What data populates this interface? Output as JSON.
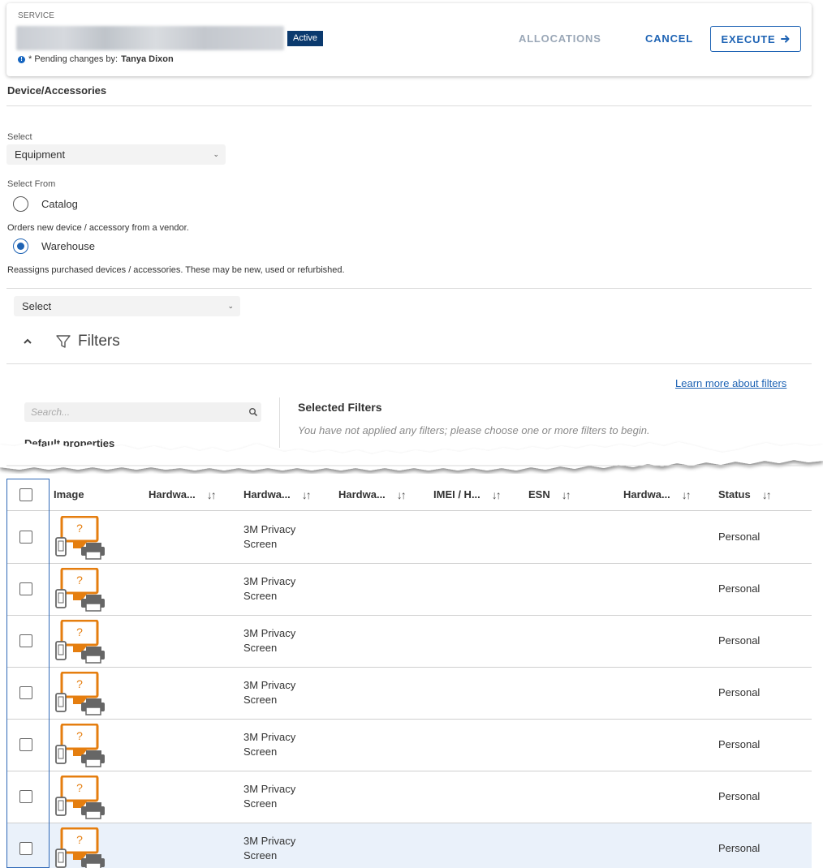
{
  "header": {
    "service_label": "SERVICE",
    "status_badge": "Active",
    "pending_text": "* Pending changes by:",
    "pending_user": "Tanya Dixon",
    "allocations_label": "ALLOCATIONS",
    "cancel_label": "CANCEL",
    "execute_label": "EXECUTE",
    "colors": {
      "primary": "#1e63b4",
      "badge": "#0b3a6e",
      "disabled": "#9aa7b7"
    }
  },
  "section": {
    "title": "Device/Accessories",
    "select_label": "Select",
    "select_value": "Equipment",
    "select_from_label": "Select From",
    "radio_options": [
      {
        "label": "Catalog",
        "checked": false,
        "help": "Orders new device / accessory from a vendor."
      },
      {
        "label": "Warehouse",
        "checked": true,
        "help": "Reassigns purchased devices / accessories. These may be new, used or refurbished."
      }
    ],
    "warehouse_select_value": "Select"
  },
  "filters": {
    "title": "Filters",
    "learn_more": "Learn more about filters",
    "search_placeholder": "Search...",
    "selected_title": "Selected Filters",
    "empty_message": "You have not applied any filters; please choose one or more filters to begin.",
    "default_properties": "Default properties"
  },
  "table": {
    "columns": [
      "Image",
      "Hardwa...",
      "Hardwa...",
      "Hardwa...",
      "IMEI / H...",
      "ESN",
      "Hardwa...",
      "Status"
    ],
    "rows": [
      {
        "name": "3M Privacy Screen",
        "status": "Personal",
        "highlighted": false
      },
      {
        "name": "3M Privacy Screen",
        "status": "Personal",
        "highlighted": false
      },
      {
        "name": "3M Privacy Screen",
        "status": "Personal",
        "highlighted": false
      },
      {
        "name": "3M Privacy Screen",
        "status": "Personal",
        "highlighted": false
      },
      {
        "name": "3M Privacy Screen",
        "status": "Personal",
        "highlighted": false
      },
      {
        "name": "3M Privacy Screen",
        "status": "Personal",
        "highlighted": false
      },
      {
        "name": "3M Privacy Screen",
        "status": "Personal",
        "highlighted": true
      }
    ],
    "row_highlight_color": "#eaf1fa",
    "image_icon": "device-placeholder-icon"
  }
}
